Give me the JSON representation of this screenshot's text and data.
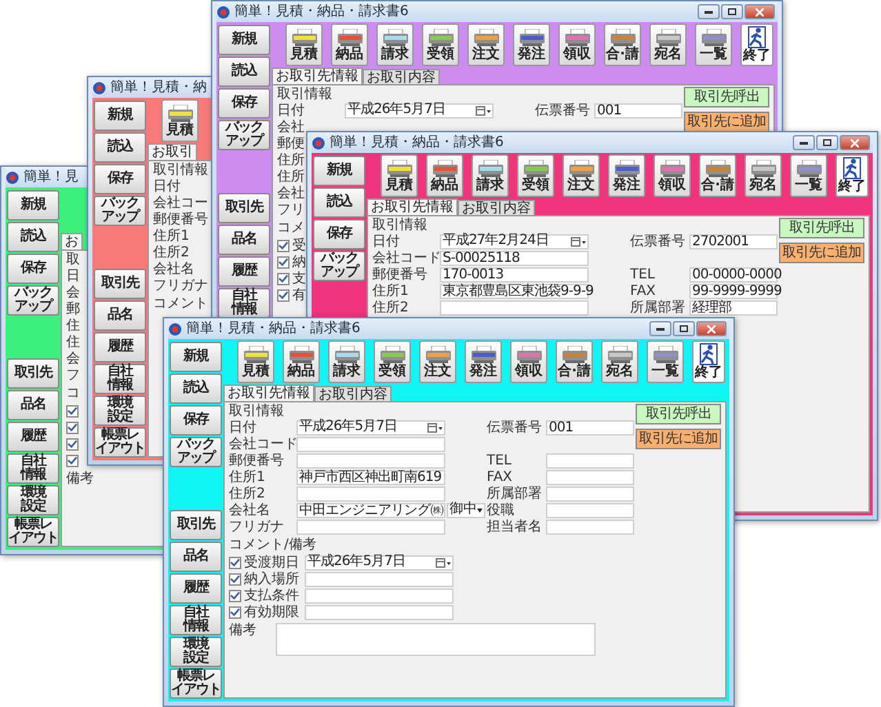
{
  "windows": [
    {
      "color": "#3cf07c",
      "title": "簡単！見",
      "sidebar_top": [
        [
          "新規"
        ],
        [
          "読込"
        ],
        [
          "保存"
        ],
        [
          "バック",
          "アップ"
        ]
      ],
      "sidebar_bottom": [
        [
          "取引先"
        ],
        [
          "品名"
        ],
        [
          "履歴"
        ],
        [
          "自社",
          "情報"
        ],
        [
          "環境",
          "設定"
        ],
        [
          "帳票レ",
          "イアウト"
        ]
      ],
      "tabs": [
        {
          "label": "お",
          "selected": true
        }
      ],
      "section": "取",
      "rows": [
        {
          "label": "日",
          "kind": "label"
        },
        {
          "label": "会",
          "kind": "label"
        },
        {
          "label": "郵",
          "kind": "label"
        },
        {
          "label": "住",
          "kind": "label"
        },
        {
          "label": "住",
          "kind": "label"
        },
        {
          "label": "会",
          "kind": "label"
        },
        {
          "label": "フ",
          "kind": "label"
        }
      ],
      "comment_header": "コ",
      "checks": [
        {
          "checked": true
        },
        {
          "checked": true
        },
        {
          "checked": true
        },
        {
          "checked": true
        }
      ],
      "memo": {
        "label": "備考",
        "kind": "label"
      }
    },
    {
      "color": "#f87a78",
      "title": "簡単！見積・納",
      "sidebar_top": [
        [
          "新規"
        ],
        [
          "読込"
        ],
        [
          "保存"
        ],
        [
          "バック",
          "アップ"
        ]
      ],
      "sidebar_bottom": [
        [
          "取引先"
        ],
        [
          "品名"
        ],
        [
          "履歴"
        ],
        [
          "自社",
          "情報"
        ],
        [
          "環境",
          "設定"
        ],
        [
          "帳票レ",
          "イアウト"
        ]
      ],
      "toolbar": [
        {
          "label": "見積",
          "color": "#f0e23c"
        }
      ],
      "tabs": [
        {
          "label": "お取引",
          "selected": true
        }
      ],
      "section": "取引情報",
      "rows": [
        {
          "label": "日付",
          "kind": "label"
        },
        {
          "label": "会社コー",
          "kind": "label"
        },
        {
          "label": "郵便番号",
          "kind": "label"
        },
        {
          "label": "住所1",
          "kind": "label"
        },
        {
          "label": "住所2",
          "kind": "label"
        },
        {
          "label": "会社名",
          "kind": "label"
        },
        {
          "label": "フリガナ",
          "kind": "label"
        }
      ],
      "comment_header": "コメント"
    },
    {
      "color": "#cc8cf0",
      "title": "簡単！見積・納品・請求書6",
      "window_controls": true,
      "sidebar_top": [
        [
          "新規"
        ],
        [
          "読込"
        ],
        [
          "保存"
        ],
        [
          "バック",
          "アップ"
        ]
      ],
      "sidebar_bottom": [
        [
          "取引先"
        ],
        [
          "品名"
        ],
        [
          "履歴"
        ],
        [
          "自社",
          "情報"
        ]
      ],
      "toolbar": [
        {
          "label": "見積",
          "color": "#f0e23c"
        },
        {
          "label": "納品",
          "color": "#e0553a"
        },
        {
          "label": "請求",
          "color": "#a8dcec"
        },
        {
          "label": "受領",
          "color": "#8cc850"
        },
        {
          "label": "注文",
          "color": "#f0a040"
        },
        {
          "label": "発注",
          "color": "#4a5cc8"
        },
        {
          "label": "領収",
          "color": "#e070b0"
        },
        {
          "label": "合·請",
          "color": "#c8843c"
        },
        {
          "label": "宛名",
          "color": "#c8c8c8"
        },
        {
          "label": "一覧",
          "color": "#9090c8"
        }
      ],
      "exit": "終了",
      "tabs": [
        {
          "label": "お取引先情報",
          "selected": true
        },
        {
          "label": "お取引内容",
          "selected": false
        }
      ],
      "section": "取引情報",
      "rows": [
        {
          "label": "日付",
          "kind": "date",
          "value": "平成26年5月7日"
        },
        {
          "label": "会社",
          "kind": "label"
        },
        {
          "label": "郵便",
          "kind": "label"
        },
        {
          "label": "住所",
          "kind": "label"
        },
        {
          "label": "住所",
          "kind": "label"
        },
        {
          "label": "会社",
          "kind": "label"
        },
        {
          "label": "フリ",
          "kind": "label"
        }
      ],
      "right_rows": [
        {
          "label": "伝票番号",
          "value": "001"
        }
      ],
      "actions": [
        {
          "label": "取引先呼出",
          "color": "#c8f8c0"
        },
        {
          "label": "取引先に追加",
          "color": "#f8b070"
        }
      ],
      "comment_header": "コメ",
      "checks": [
        {
          "label": "受",
          "checked": true,
          "kind": "label"
        },
        {
          "label": "納",
          "checked": true,
          "kind": "label"
        },
        {
          "label": "支",
          "checked": true,
          "kind": "label"
        },
        {
          "label": "有",
          "checked": true,
          "kind": "label"
        }
      ]
    },
    {
      "color": "#f0357c",
      "title": "簡単！見積・納品・請求書6",
      "window_controls": true,
      "sidebar_top": [
        [
          "新規"
        ],
        [
          "読込"
        ],
        [
          "保存"
        ],
        [
          "バック",
          "アップ"
        ]
      ],
      "toolbar": [
        {
          "label": "見積",
          "color": "#f0e23c"
        },
        {
          "label": "納品",
          "color": "#e0553a"
        },
        {
          "label": "請求",
          "color": "#a8dcec"
        },
        {
          "label": "受領",
          "color": "#8cc850"
        },
        {
          "label": "注文",
          "color": "#f0a040"
        },
        {
          "label": "発注",
          "color": "#4a5cc8"
        },
        {
          "label": "領収",
          "color": "#e070b0"
        },
        {
          "label": "合·請",
          "color": "#c8843c"
        },
        {
          "label": "宛名",
          "color": "#c8c8c8"
        },
        {
          "label": "一覧",
          "color": "#9090c8"
        }
      ],
      "exit": "終了",
      "tabs": [
        {
          "label": "お取引先情報",
          "selected": true
        },
        {
          "label": "お取引内容",
          "selected": false
        }
      ],
      "section": "取引情報",
      "rows": [
        {
          "label": "日付",
          "kind": "date",
          "value": "平成27年2月24日"
        },
        {
          "label": "会社コード",
          "kind": "text",
          "value": "S-00025118"
        },
        {
          "label": "郵便番号",
          "kind": "text",
          "value": "170-0013"
        },
        {
          "label": "住所1",
          "kind": "text",
          "value": "東京都豊島区東池袋9-9-9"
        },
        {
          "label": "住所2",
          "kind": "text"
        }
      ],
      "right_rows": [
        {
          "label": "伝票番号",
          "value": "2702001"
        },
        {
          "label": "TEL",
          "value": "00-0000-0000"
        },
        {
          "label": "FAX",
          "value": "99-9999-9999"
        },
        {
          "label": "所属部署",
          "value": "経理部"
        }
      ],
      "actions": [
        {
          "label": "取引先呼出",
          "color": "#c8f8c0"
        },
        {
          "label": "取引先に追加",
          "color": "#f8b070"
        }
      ]
    },
    {
      "color": "#10f4f4",
      "title": "簡単！見積・納品・請求書6",
      "window_controls": true,
      "sidebar_top": [
        [
          "新規"
        ],
        [
          "読込"
        ],
        [
          "保存"
        ],
        [
          "バック",
          "アップ"
        ]
      ],
      "sidebar_bottom": [
        [
          "取引先"
        ],
        [
          "品名"
        ],
        [
          "履歴"
        ],
        [
          "自社",
          "情報"
        ],
        [
          "環境",
          "設定"
        ],
        [
          "帳票レ",
          "イアウト"
        ]
      ],
      "toolbar": [
        {
          "label": "見積",
          "color": "#f0e23c"
        },
        {
          "label": "納品",
          "color": "#e0553a"
        },
        {
          "label": "請求",
          "color": "#a8dcec"
        },
        {
          "label": "受領",
          "color": "#8cc850"
        },
        {
          "label": "注文",
          "color": "#f0a040"
        },
        {
          "label": "発注",
          "color": "#4a5cc8"
        },
        {
          "label": "領収",
          "color": "#e070b0"
        },
        {
          "label": "合·請",
          "color": "#c8843c"
        },
        {
          "label": "宛名",
          "color": "#c8c8c8"
        },
        {
          "label": "一覧",
          "color": "#9090c8"
        }
      ],
      "exit": "終了",
      "tabs": [
        {
          "label": "お取引先情報",
          "selected": true
        },
        {
          "label": "お取引内容",
          "selected": false
        }
      ],
      "section": "取引情報",
      "rows": [
        {
          "label": "日付",
          "kind": "date",
          "value": "平成26年5月7日"
        },
        {
          "label": "会社コード",
          "kind": "text"
        },
        {
          "label": "郵便番号",
          "kind": "text"
        },
        {
          "label": "住所1",
          "kind": "text",
          "value": "神戸市西区神出町南619"
        },
        {
          "label": "住所2",
          "kind": "text"
        },
        {
          "label": "会社名",
          "kind": "company",
          "value": "中田エンジニアリング㈱",
          "suffix": "御中"
        },
        {
          "label": "フリガナ",
          "kind": "text"
        }
      ],
      "right_rows": [
        {
          "label": "伝票番号",
          "value": "001"
        },
        {
          "label": "TEL"
        },
        {
          "label": "FAX"
        },
        {
          "label": "所属部署"
        },
        {
          "label": "役職"
        },
        {
          "label": "担当者名"
        }
      ],
      "actions": [
        {
          "label": "取引先呼出",
          "color": "#c8f8c0"
        },
        {
          "label": "取引先に追加",
          "color": "#f8b070"
        }
      ],
      "comment_header": "コメント/備考",
      "checks": [
        {
          "label": "受渡期日",
          "checked": true,
          "kind": "date",
          "value": "平成26年5月7日"
        },
        {
          "label": "納入場所",
          "checked": true,
          "kind": "text"
        },
        {
          "label": "支払条件",
          "checked": true,
          "kind": "text"
        },
        {
          "label": "有効期限",
          "checked": true,
          "kind": "text"
        }
      ],
      "memo": {
        "label": "備考",
        "kind": "field"
      }
    }
  ]
}
